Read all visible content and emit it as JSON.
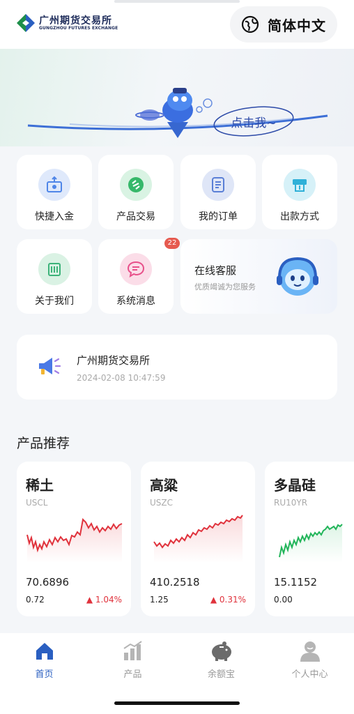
{
  "header": {
    "logo_cn": "广州期货交易所",
    "logo_en": "GUNGZHOU FUTURES EXCHANGE",
    "language_label": "简体中文"
  },
  "banner": {
    "bubble_text": "点击我~"
  },
  "quick_actions": [
    {
      "label": "快捷入金",
      "icon": "deposit-icon",
      "color": "#4f86e8"
    },
    {
      "label": "产品交易",
      "icon": "trade-icon",
      "color": "#36b86a"
    },
    {
      "label": "我的订单",
      "icon": "order-icon",
      "color": "#5a7fd6"
    },
    {
      "label": "出款方式",
      "icon": "withdraw-icon",
      "color": "#2fb0d8"
    },
    {
      "label": "关于我们",
      "icon": "about-icon",
      "color": "#3db37a"
    },
    {
      "label": "系统消息",
      "icon": "message-icon",
      "color": "#e8508a",
      "badge": "22"
    }
  ],
  "service": {
    "title": "在线客服",
    "subtitle": "优质竭诚为您服务"
  },
  "notice": {
    "title": "广州期货交易所",
    "time": "2024-02-08 10:47:59"
  },
  "products_section_title": "产品推荐",
  "products": [
    {
      "name": "稀土",
      "code": "USCL",
      "price": "70.6896",
      "change": "0.72",
      "percent": "1.04%",
      "trend": "up",
      "color": "#e0323c"
    },
    {
      "name": "高粱",
      "code": "USZC",
      "price": "410.2518",
      "change": "1.25",
      "percent": "0.31%",
      "trend": "up",
      "color": "#e0323c"
    },
    {
      "name": "多晶硅",
      "code": "RU10YR",
      "price": "15.1152",
      "change": "0.00",
      "percent": "",
      "trend": "up",
      "color": "#22b55a"
    }
  ],
  "nav": [
    {
      "label": "首页",
      "icon": "home-icon",
      "active": true
    },
    {
      "label": "产品",
      "icon": "chart-icon",
      "active": false
    },
    {
      "label": "余额宝",
      "icon": "piggy-bank-icon",
      "active": false
    },
    {
      "label": "个人中心",
      "icon": "user-icon",
      "active": false
    }
  ],
  "colors": {
    "accent": "#2a5fc1",
    "up": "#e0323c",
    "nav_inactive": "#999999"
  }
}
